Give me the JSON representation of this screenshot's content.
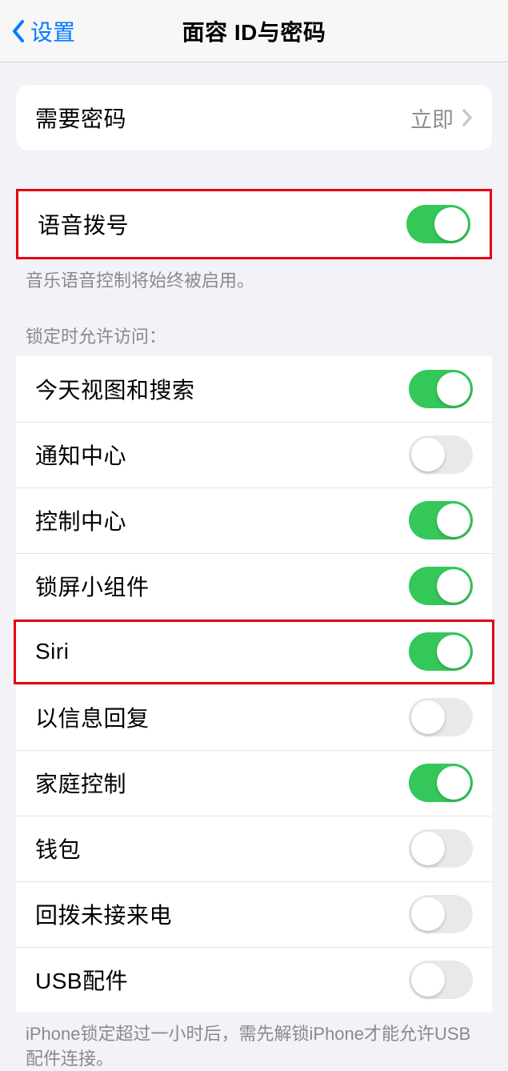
{
  "header": {
    "back_label": "设置",
    "title": "面容 ID与密码"
  },
  "require_passcode": {
    "label": "需要密码",
    "value": "立即"
  },
  "voice_dial": {
    "label": "语音拨号",
    "enabled": true,
    "footer": "音乐语音控制将始终被启用。"
  },
  "locked_access": {
    "header": "锁定时允许访问：",
    "items": [
      {
        "label": "今天视图和搜索",
        "enabled": true
      },
      {
        "label": "通知中心",
        "enabled": false
      },
      {
        "label": "控制中心",
        "enabled": true
      },
      {
        "label": "锁屏小组件",
        "enabled": true
      },
      {
        "label": "Siri",
        "enabled": true
      },
      {
        "label": "以信息回复",
        "enabled": false
      },
      {
        "label": "家庭控制",
        "enabled": true
      },
      {
        "label": "钱包",
        "enabled": false
      },
      {
        "label": "回拨未接来电",
        "enabled": false
      },
      {
        "label": "USB配件",
        "enabled": false
      }
    ],
    "footer": "iPhone锁定超过一小时后，需先解锁iPhone才能允许USB 配件连接。"
  }
}
